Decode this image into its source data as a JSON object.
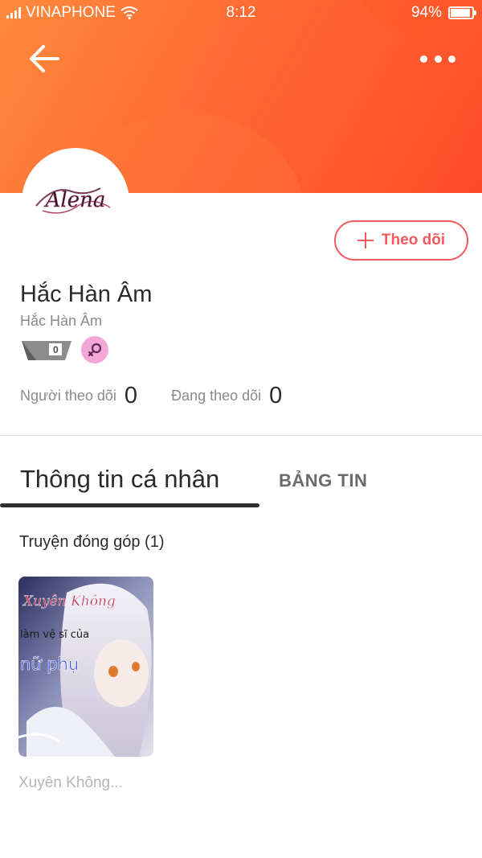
{
  "status_bar": {
    "carrier": "VINAPHONE",
    "time": "8:12",
    "battery": "94%",
    "battery_level": 0.94
  },
  "colors": {
    "header_gradient_start": "#ff8a3c",
    "header_gradient_end": "#ff4a2a",
    "accent": "#f2585c",
    "gender_badge": "#f4a6d6"
  },
  "header": {
    "back_icon": "arrow-left-icon",
    "more_icon": "more-dots-icon"
  },
  "profile": {
    "avatar_text": "Alena",
    "follow_button": "Theo dõi",
    "name": "Hắc Hàn Âm",
    "username": "Hắc Hàn Âm",
    "level": "0",
    "gender_icon": "female-icon",
    "stats": {
      "followers_label": "Người theo dõi",
      "followers_value": "0",
      "following_label": "Đang theo dõi",
      "following_value": "0"
    }
  },
  "tabs": [
    {
      "label": "Thông tin cá nhân",
      "active": true
    },
    {
      "label": "BẢNG TIN",
      "active": false
    }
  ],
  "contributions": {
    "title": "Truyện đóng góp (1)",
    "items": [
      {
        "cover_line1": "Xuyên Không",
        "cover_line2": "làm vệ sĩ của",
        "cover_line3": "nữ phụ",
        "title": "Xuyên Không..."
      }
    ]
  }
}
